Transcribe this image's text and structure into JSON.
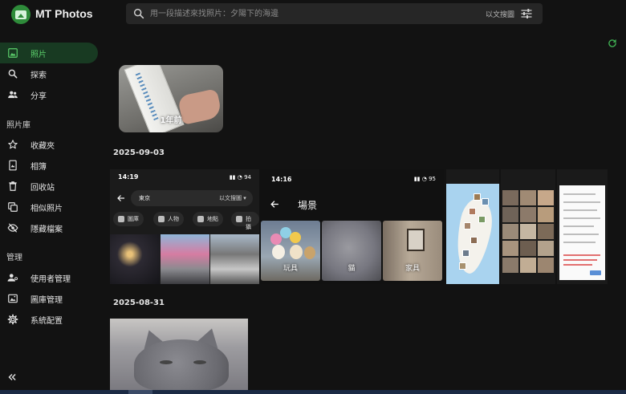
{
  "app": {
    "name": "MT Photos"
  },
  "search": {
    "placeholder": "用一段描述來找照片：夕陽下的海邊",
    "mode_label": "以文搜圖"
  },
  "sidebar": {
    "items": [
      {
        "label": "照片",
        "icon": "photo-icon"
      },
      {
        "label": "探索",
        "icon": "search-icon"
      },
      {
        "label": "分享",
        "icon": "people-icon"
      }
    ],
    "library_header": "照片庫",
    "library_items": [
      {
        "label": "收藏夾",
        "icon": "star-icon"
      },
      {
        "label": "相簿",
        "icon": "album-icon"
      },
      {
        "label": "回收站",
        "icon": "trash-icon"
      },
      {
        "label": "相似照片",
        "icon": "similar-photos-icon"
      },
      {
        "label": "隱藏檔案",
        "icon": "eye-off-icon"
      }
    ],
    "admin_header": "管理",
    "admin_items": [
      {
        "label": "使用者管理",
        "icon": "user-manage-icon"
      },
      {
        "label": "圖庫管理",
        "icon": "gallery-icon"
      },
      {
        "label": "系統配置",
        "icon": "gear-icon"
      }
    ]
  },
  "memory": {
    "label": "1年前"
  },
  "groups": [
    {
      "date": "2025-09-03"
    },
    {
      "date": "2025-08-31"
    }
  ],
  "screenshot1": {
    "time": "14:19",
    "status_right": "▮▮ ◔ 94",
    "search_text": "東京",
    "search_mode": "以文搜圖 ▾",
    "chips": [
      "圖庫",
      "人物",
      "地點",
      "拍攝"
    ]
  },
  "screenshot2": {
    "time": "14:16",
    "status_right": "▮▮ ◔ 95",
    "title": "場景",
    "cards": [
      "玩具",
      "貓",
      "家具"
    ]
  },
  "colors": {
    "accent": "#5cd06c",
    "active_bg": "#183a22",
    "background": "#121212"
  }
}
